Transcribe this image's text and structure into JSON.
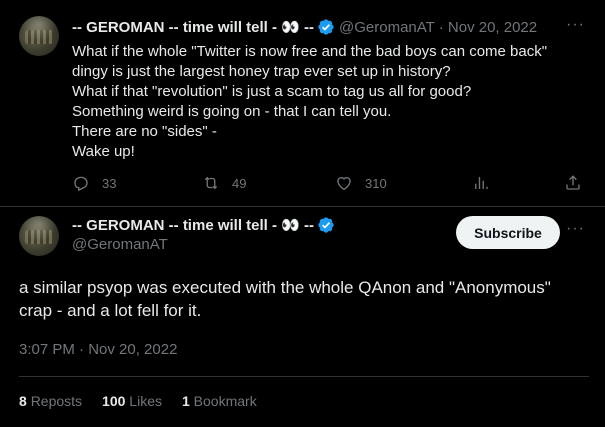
{
  "tweet_quoted": {
    "display_name": "-- GEROMAN -- time will tell - 👀 --",
    "handle": "@GeromanAT",
    "date": "Nov 20, 2022",
    "lines": [
      "What if the whole \"Twitter is now free and the bad boys can come back\"",
      "dingy is just the largest honey trap ever set up in history?",
      "What if that \"revolution\" is just a scam to tag us all for good?",
      "Something weird is going on - that I can tell you.",
      "There are no \"sides\" -",
      "Wake up!"
    ],
    "replies": "33",
    "reposts": "49",
    "likes": "310",
    "more": "···"
  },
  "tweet_main": {
    "display_name": "-- GEROMAN -- time will tell - 👀 --",
    "handle": "@GeromanAT",
    "subscribe_label": "Subscribe",
    "lines": [
      "a similar psyop was executed with the whole QAnon and \"Anonymous\"",
      "crap - and a lot fell for it."
    ],
    "timestamp": "3:07 PM · Nov 20, 2022",
    "more": "···"
  },
  "stats": {
    "reposts_count": "8",
    "reposts_label": "Reposts",
    "likes_count": "100",
    "likes_label": "Likes",
    "bookmarks_count": "1",
    "bookmarks_label": "Bookmark"
  },
  "colors": {
    "background": "#000000",
    "text": "#e7e9ea",
    "muted": "#71767b",
    "verified": "#1d9bf0",
    "button_bg": "#eff3f4"
  },
  "icons": [
    "verified-badge-icon",
    "reply-icon",
    "repost-icon",
    "like-icon",
    "views-icon",
    "share-icon",
    "more-icon"
  ]
}
